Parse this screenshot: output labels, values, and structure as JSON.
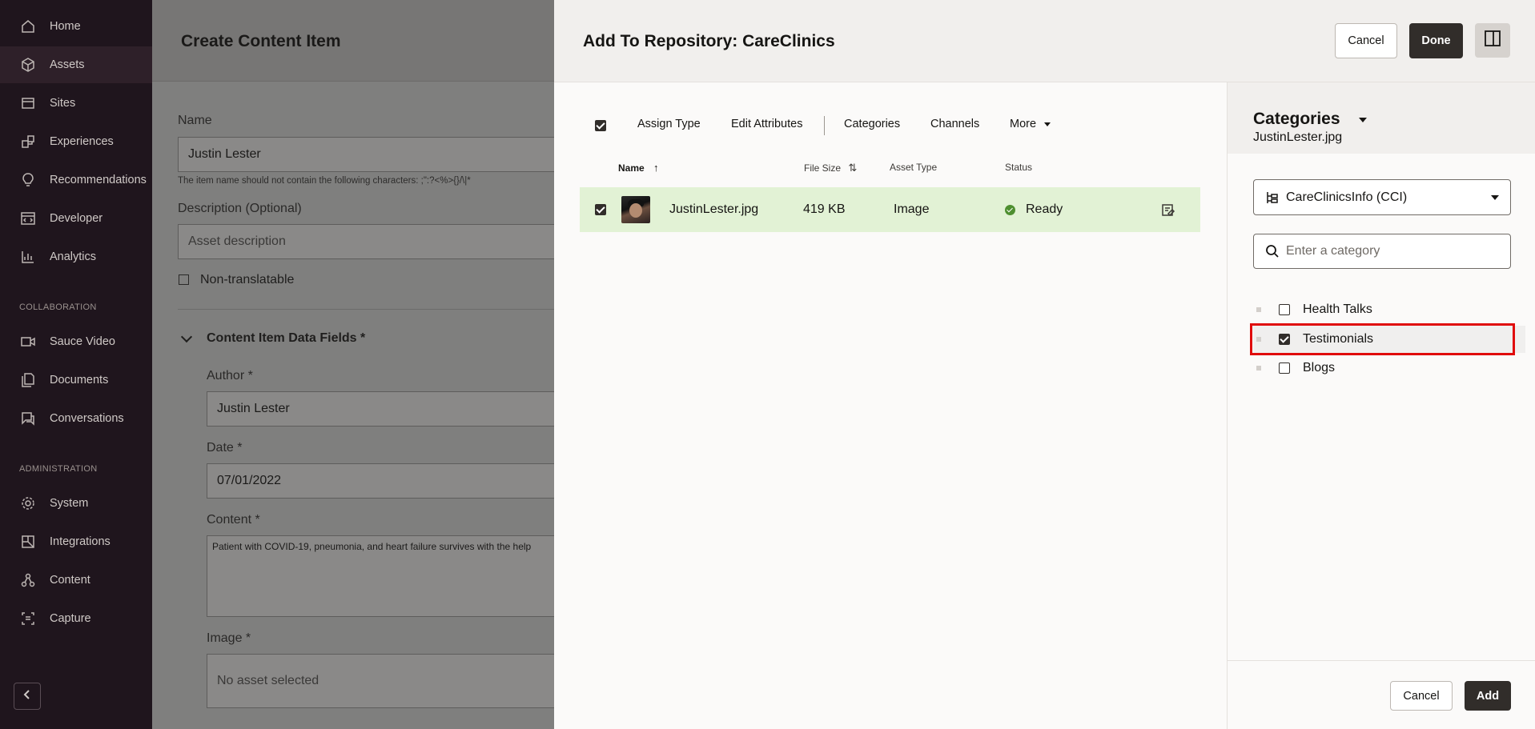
{
  "sidebar": {
    "items": [
      {
        "label": "Home",
        "icon": "home-icon"
      },
      {
        "label": "Assets",
        "icon": "cube-icon"
      },
      {
        "label": "Sites",
        "icon": "sites-icon"
      },
      {
        "label": "Experiences",
        "icon": "experiences-icon"
      },
      {
        "label": "Recommendations",
        "icon": "lightbulb-icon"
      },
      {
        "label": "Developer",
        "icon": "code-icon"
      },
      {
        "label": "Analytics",
        "icon": "chart-icon"
      }
    ],
    "collaboration_label": "COLLABORATION",
    "collab_items": [
      {
        "label": "Sauce Video",
        "icon": "video-icon"
      },
      {
        "label": "Documents",
        "icon": "documents-icon"
      },
      {
        "label": "Conversations",
        "icon": "conversations-icon"
      }
    ],
    "administration_label": "ADMINISTRATION",
    "admin_items": [
      {
        "label": "System",
        "icon": "gear-icon"
      },
      {
        "label": "Integrations",
        "icon": "integrations-icon"
      },
      {
        "label": "Content",
        "icon": "content-icon"
      },
      {
        "label": "Capture",
        "icon": "capture-icon"
      }
    ]
  },
  "background_form": {
    "title": "Create Content Item",
    "name_label": "Name",
    "name_value": "Justin Lester",
    "name_hint": "The item name should not contain the following characters: ;\":?<%>{}/\\|*",
    "description_label": "Description (Optional)",
    "description_placeholder": "Asset description",
    "non_translatable_label": "Non-translatable",
    "data_fields_label": "Content Item Data Fields *",
    "author_label": "Author *",
    "author_value": "Justin Lester",
    "date_label": "Date *",
    "date_value": "07/01/2022",
    "content_label": "Content *",
    "content_value": "Patient with COVID-19, pneumonia, and heart failure survives with the help",
    "image_label": "Image *",
    "image_placeholder": "No asset selected"
  },
  "dialog": {
    "title": "Add To Repository: CareClinics",
    "cancel_label": "Cancel",
    "done_label": "Done",
    "toolbar": {
      "assign_type": "Assign Type",
      "edit_attributes": "Edit Attributes",
      "categories": "Categories",
      "channels": "Channels",
      "more": "More"
    },
    "table": {
      "columns": [
        "Name",
        "File Size",
        "Asset Type",
        "Status"
      ],
      "rows": [
        {
          "name": "JustinLester.jpg",
          "size": "419 KB",
          "type": "Image",
          "status": "Ready"
        }
      ]
    }
  },
  "categories_panel": {
    "title": "Categories",
    "subtitle": "JustinLester.jpg",
    "taxonomy_selected": "CareClinicsInfo (CCI)",
    "search_placeholder": "Enter a category",
    "items": [
      {
        "label": "Health Talks",
        "checked": false
      },
      {
        "label": "Testimonials",
        "checked": true
      },
      {
        "label": "Blogs",
        "checked": false
      }
    ],
    "cancel_label": "Cancel",
    "add_label": "Add"
  },
  "colors": {
    "sidebar_bg": "#1f151d",
    "primary_button": "#312d2a",
    "selected_row": "#e2f2d5",
    "status_ready": "#4e8f30",
    "highlight_border": "#e00b0b"
  }
}
